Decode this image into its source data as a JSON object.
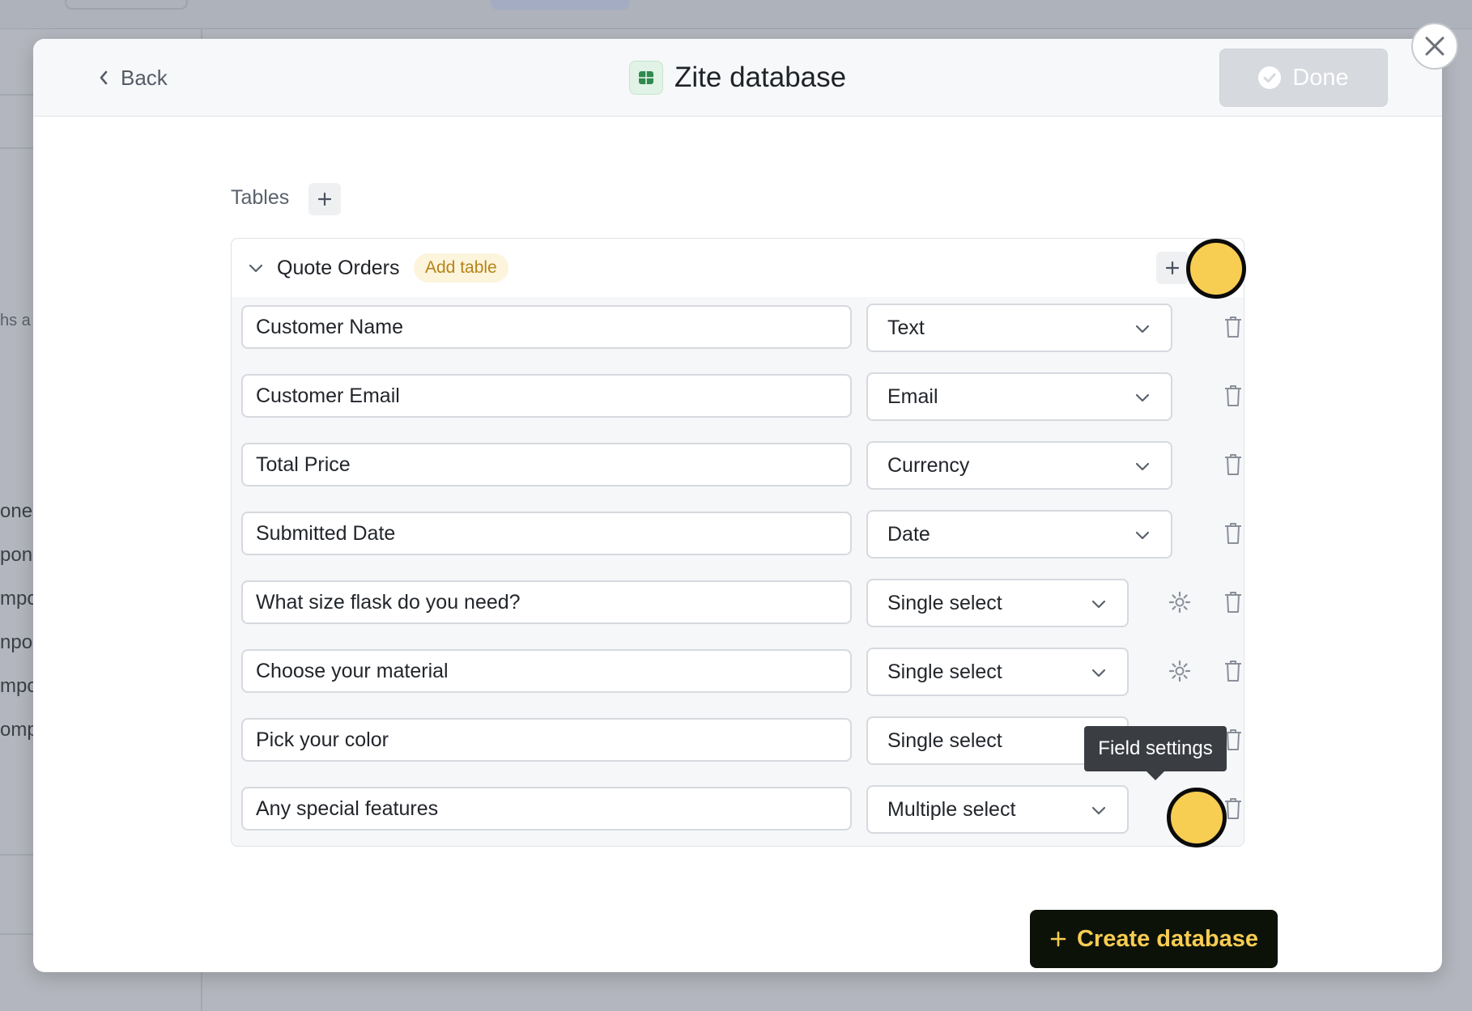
{
  "background": {
    "partial_texts": [
      "hs a",
      "oner",
      "pon",
      "mpo",
      "npor",
      "mpo",
      "omp"
    ]
  },
  "modal": {
    "back_label": "Back",
    "title": "Zite database",
    "done_label": "Done",
    "tables_label": "Tables",
    "table": {
      "name": "Quote Orders",
      "badge": "Add table",
      "fields": [
        {
          "name": "Customer Name",
          "type": "Text",
          "has_settings": false
        },
        {
          "name": "Customer Email",
          "type": "Email",
          "has_settings": false
        },
        {
          "name": "Total Price",
          "type": "Currency",
          "has_settings": false
        },
        {
          "name": "Submitted Date",
          "type": "Date",
          "has_settings": false
        },
        {
          "name": "What size flask do you need?",
          "type": "Single select",
          "has_settings": true
        },
        {
          "name": "Choose your material",
          "type": "Single select",
          "has_settings": true
        },
        {
          "name": "Pick your color",
          "type": "Single select",
          "has_settings": true
        },
        {
          "name": "Any special features",
          "type": "Multiple select",
          "has_settings": true
        }
      ]
    },
    "tooltip": "Field settings",
    "create_label": "Create database"
  },
  "icons": {
    "back": "chevron-left-icon",
    "db": "table-grid-icon",
    "done": "check-circle-icon",
    "close": "close-icon",
    "collapse": "chevron-down-icon",
    "type_dropdown": "chevron-down-icon",
    "settings": "gear-icon",
    "delete": "trash-icon",
    "add": "plus-icon"
  },
  "colors": {
    "accent_yellow": "#f7cd52",
    "create_button_bg": "#0d1209",
    "done_disabled_bg": "#d6d9de",
    "db_icon_green": "#2f8a4e",
    "badge_bg": "#fdf4dc",
    "badge_text": "#b58417"
  }
}
